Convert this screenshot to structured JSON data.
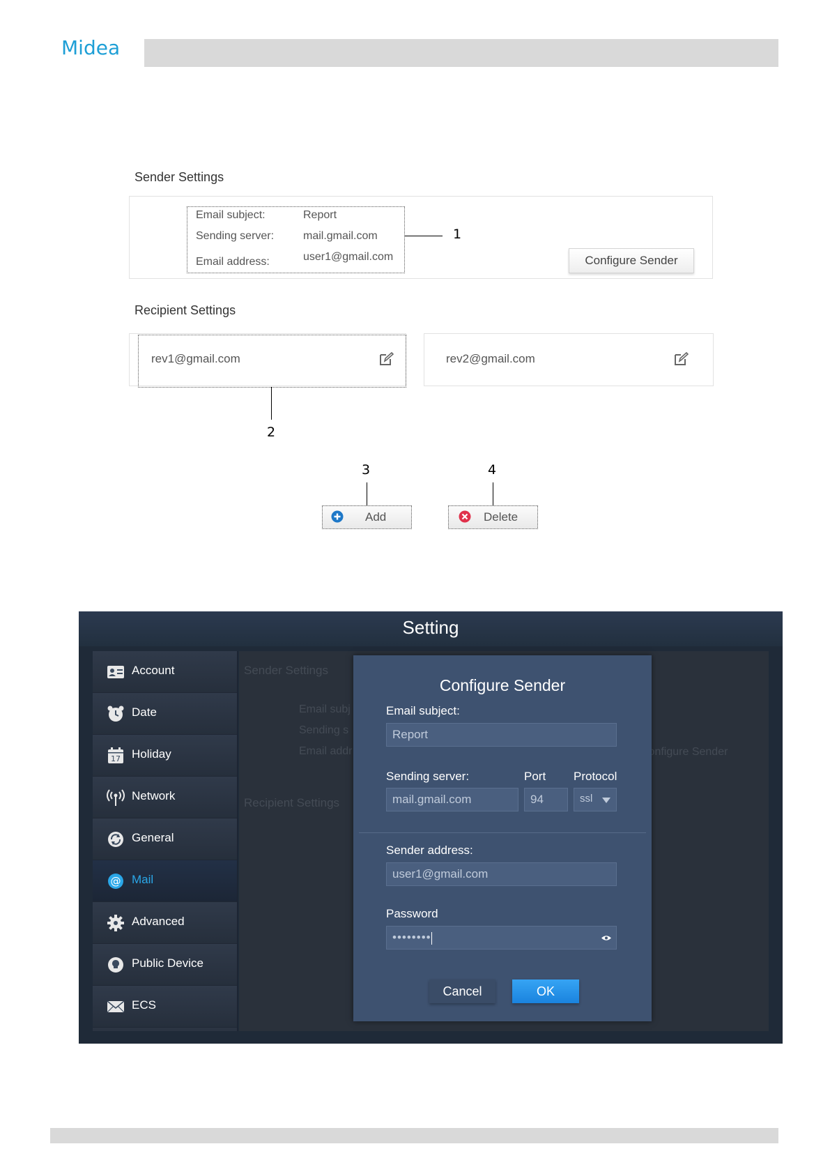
{
  "header": {
    "logo": "Midea"
  },
  "figure1": {
    "sender_title": "Sender Settings",
    "email_subject_label": "Email subject:",
    "email_subject_value": "Report",
    "sending_server_label": "Sending server:",
    "sending_server_value": "mail.gmail.com",
    "email_address_label": "Email address:",
    "email_address_value": "user1@gmail.com",
    "configure_button": "Configure Sender",
    "recipient_title": "Recipient Settings",
    "recipients": [
      "rev1@gmail.com",
      "rev2@gmail.com"
    ],
    "add_button": "Add",
    "delete_button": "Delete",
    "callouts": [
      "1",
      "2",
      "3",
      "4"
    ]
  },
  "figure2": {
    "window_title": "Setting",
    "sidebar": [
      {
        "label": "Account",
        "icon": "account-icon"
      },
      {
        "label": "Date",
        "icon": "clock-icon"
      },
      {
        "label": "Holiday",
        "icon": "calendar-icon",
        "day": "17"
      },
      {
        "label": "Network",
        "icon": "network-icon"
      },
      {
        "label": "General",
        "icon": "refresh-icon"
      },
      {
        "label": "Mail",
        "icon": "mail-at-icon",
        "active": true
      },
      {
        "label": "Advanced",
        "icon": "gear-icon"
      },
      {
        "label": "Public Device",
        "icon": "bulb-icon"
      },
      {
        "label": "ECS",
        "icon": "envelope-icon"
      }
    ],
    "background": {
      "sender_title": "Sender Settings",
      "subject_label": "Email subj",
      "server_label": "Sending s",
      "address_label": "Email addr",
      "configure_button": "Configure Sender",
      "recipient_title": "Recipient Settings"
    },
    "dialog": {
      "title": "Configure Sender",
      "email_subject_label": "Email subject:",
      "email_subject_value": "Report",
      "sending_server_label": "Sending server:",
      "port_label": "Port",
      "protocol_label": "Protocol",
      "sending_server_value": "mail.gmail.com",
      "port_value": "94",
      "protocol_value": "ssl",
      "sender_address_label": "Sender address:",
      "sender_address_value": "user1@gmail.com",
      "password_label": "Password",
      "password_value": "••••••••",
      "cancel_button": "Cancel",
      "ok_button": "OK"
    }
  },
  "colors": {
    "brand": "#1e9fd6",
    "dialog_bg": "#3e5270",
    "ok_button": "#1a83de",
    "active_tab": "#2aa7e8"
  }
}
